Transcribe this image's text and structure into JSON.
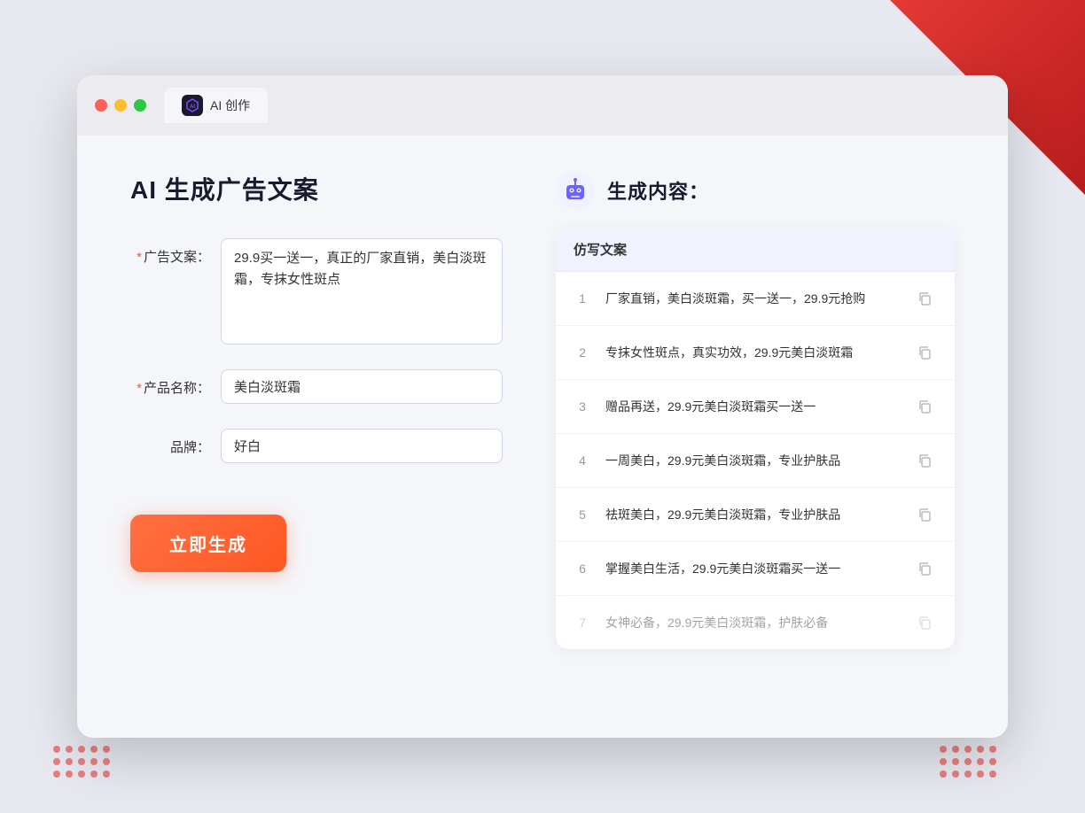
{
  "window": {
    "tab_label": "AI 创作",
    "tab_icon_text": "AI"
  },
  "left_panel": {
    "title": "AI 生成广告文案",
    "ad_copy_label": "广告文案：",
    "ad_copy_required": "*",
    "ad_copy_value": "29.9买一送一，真正的厂家直销，美白淡斑霜，专抹女性斑点",
    "product_name_label": "产品名称：",
    "product_name_required": "*",
    "product_name_value": "美白淡斑霜",
    "brand_label": "品牌：",
    "brand_value": "好白",
    "generate_btn_label": "立即生成"
  },
  "right_panel": {
    "title": "生成内容：",
    "column_header": "仿写文案",
    "items": [
      {
        "num": "1",
        "text": "厂家直销，美白淡斑霜，买一送一，29.9元抢购"
      },
      {
        "num": "2",
        "text": "专抹女性斑点，真实功效，29.9元美白淡斑霜"
      },
      {
        "num": "3",
        "text": "赠品再送，29.9元美白淡斑霜买一送一"
      },
      {
        "num": "4",
        "text": "一周美白，29.9元美白淡斑霜，专业护肤品"
      },
      {
        "num": "5",
        "text": "祛斑美白，29.9元美白淡斑霜，专业护肤品"
      },
      {
        "num": "6",
        "text": "掌握美白生活，29.9元美白淡斑霜买一送一"
      },
      {
        "num": "7",
        "text": "女神必备，29.9元美白淡斑霜，护肤必备"
      }
    ]
  }
}
